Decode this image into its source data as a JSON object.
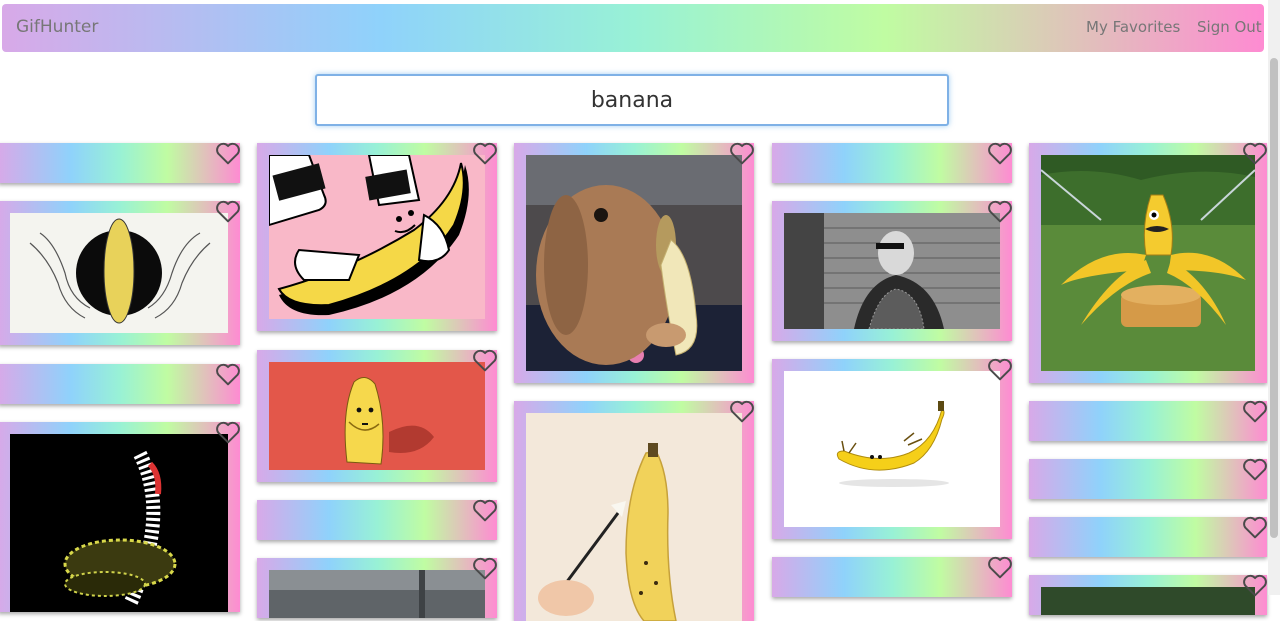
{
  "navbar": {
    "brand": "GifHunter",
    "links": [
      "My Favorites",
      "Sign Out"
    ]
  },
  "search": {
    "value": "banana",
    "placeholder": ""
  },
  "icons": {
    "favorite": "heart-outline-icon"
  },
  "colors": {
    "gradient": [
      "#d8a9e8",
      "#8fd2fb",
      "#98f1d6",
      "#c0fca2",
      "#fe8bd2"
    ],
    "focus_border": "#7fb1e6",
    "nav_text": "#777777"
  },
  "gifs": [
    {
      "id": "c1-1",
      "image": "empty"
    },
    {
      "id": "c1-2",
      "image": "hands-banana-circle"
    },
    {
      "id": "c1-3",
      "image": "empty"
    },
    {
      "id": "c1-4",
      "image": "psychedelic-banana"
    },
    {
      "id": "c2-1",
      "image": "cartoon-peeling-banana"
    },
    {
      "id": "c2-2",
      "image": "cartoon-shy-banana"
    },
    {
      "id": "c2-3",
      "image": "empty"
    },
    {
      "id": "c2-4",
      "image": "hallway"
    },
    {
      "id": "c3-1",
      "image": "bunny-eating-banana"
    },
    {
      "id": "c3-2",
      "image": "painting-banana"
    },
    {
      "id": "c4-1",
      "image": "empty"
    },
    {
      "id": "c4-2",
      "image": "bald-man-brick-wall"
    },
    {
      "id": "c4-3",
      "image": "banana-relaxing"
    },
    {
      "id": "c4-4",
      "image": "empty"
    },
    {
      "id": "c5-1",
      "image": "banana-sprinkler-pancakes"
    },
    {
      "id": "c5-2",
      "image": "empty"
    },
    {
      "id": "c5-3",
      "image": "empty"
    },
    {
      "id": "c5-4",
      "image": "empty"
    },
    {
      "id": "c5-5",
      "image": "grass"
    }
  ]
}
